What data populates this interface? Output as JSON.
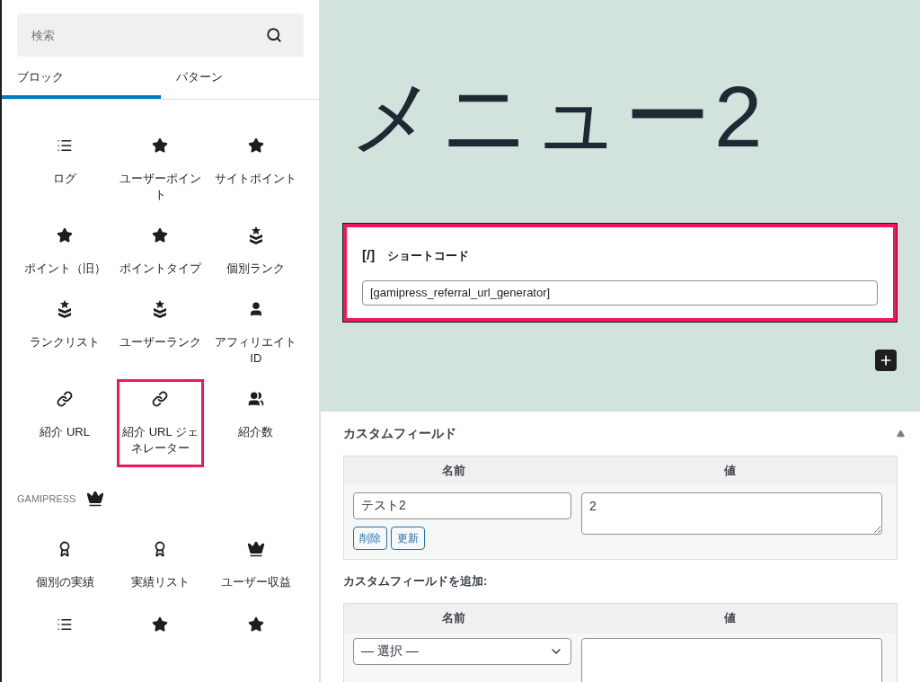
{
  "sidebar": {
    "search": {
      "placeholder": "検索"
    },
    "tabs": [
      {
        "label": "ブロック",
        "selected": true
      },
      {
        "label": "パターン",
        "selected": false
      }
    ],
    "blocks": [
      {
        "kind": "list",
        "label": "ログ",
        "highlighted": false
      },
      {
        "kind": "star",
        "label": "ユーザーポイント",
        "highlighted": false
      },
      {
        "kind": "star",
        "label": "サイトポイント",
        "highlighted": false
      },
      {
        "kind": "star",
        "label": "ポイント（旧）",
        "highlighted": false
      },
      {
        "kind": "star",
        "label": "ポイントタイプ",
        "highlighted": false
      },
      {
        "kind": "rank",
        "label": "個別ランク",
        "highlighted": false
      },
      {
        "kind": "rank",
        "label": "ランクリスト",
        "highlighted": false
      },
      {
        "kind": "rank",
        "label": "ユーザーランク",
        "highlighted": false
      },
      {
        "kind": "user",
        "label": "アフィリエイト ID",
        "highlighted": false
      },
      {
        "kind": "link",
        "label": "紹介 URL",
        "highlighted": false
      },
      {
        "kind": "link",
        "label": "紹介 URL ジェネレーター",
        "highlighted": true
      },
      {
        "kind": "group",
        "label": "紹介数",
        "highlighted": false
      }
    ],
    "category": {
      "label": "GAMIPRESS",
      "kind": "crown"
    },
    "category_blocks": [
      {
        "kind": "award",
        "label": "個別の実績"
      },
      {
        "kind": "award",
        "label": "実績リスト"
      },
      {
        "kind": "crown",
        "label": "ユーザー収益"
      },
      {
        "kind": "list"
      },
      {
        "kind": "star"
      },
      {
        "kind": "star"
      }
    ]
  },
  "canvas": {
    "title": "メニュー2",
    "shortcode_block": {
      "icon": "[/]",
      "label": "ショートコード",
      "value": "[gamipress_referral_url_generator]",
      "highlighted": true
    }
  },
  "custom_fields": {
    "title": "カスタムフィールド",
    "expanded": true,
    "columns": [
      "名前",
      "値"
    ],
    "rows": [
      {
        "name": "テスト2",
        "value": "2",
        "buttons": [
          "削除",
          "更新"
        ]
      }
    ],
    "add_title": "カスタムフィールドを追加:",
    "add_columns": [
      "名前",
      "値"
    ],
    "add_select": "— 選択 —"
  }
}
